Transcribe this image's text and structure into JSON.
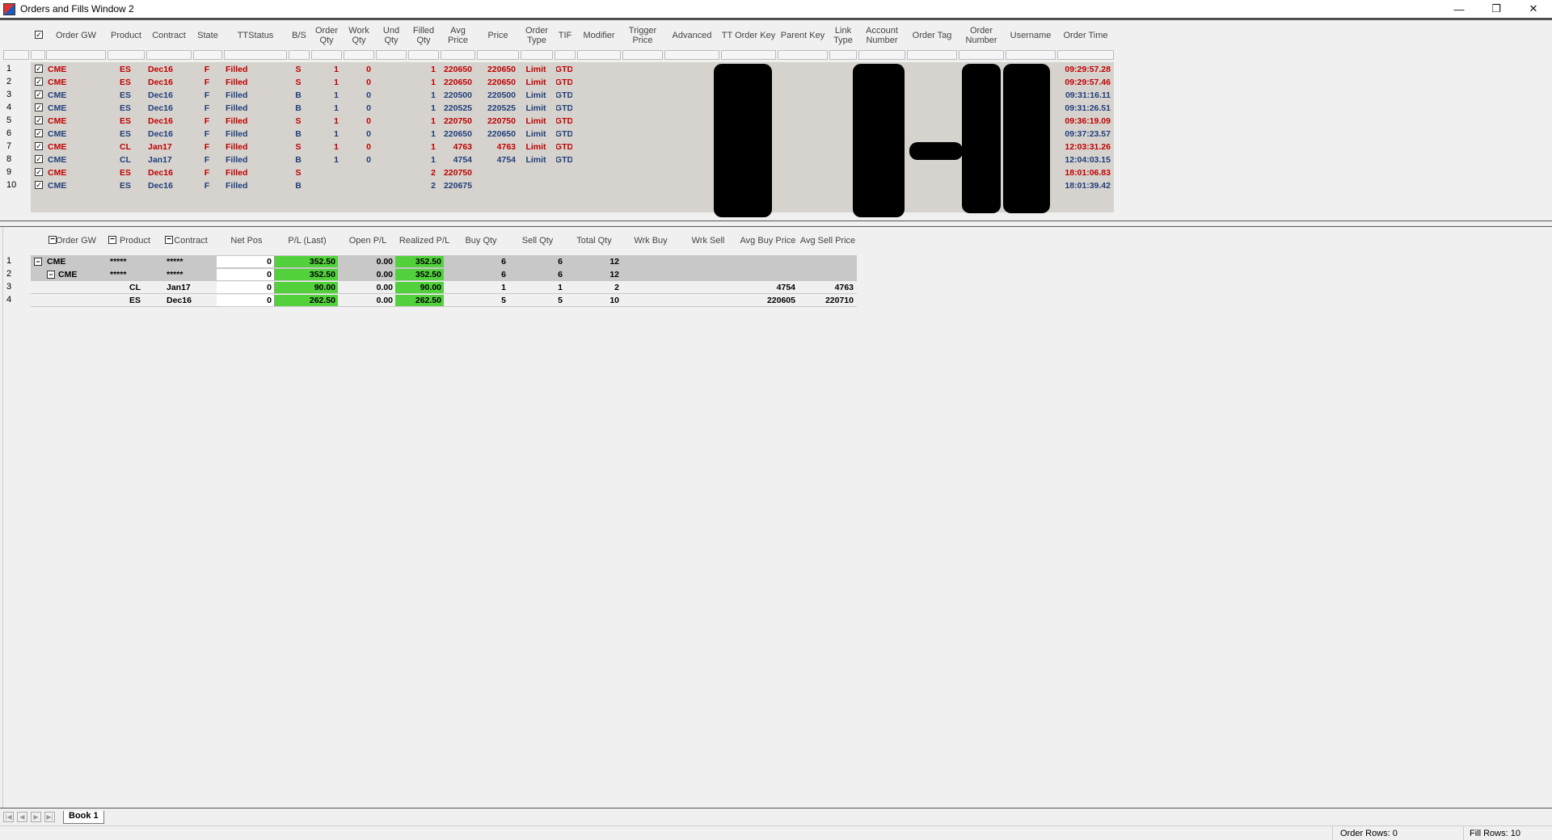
{
  "window": {
    "title": "Orders and Fills Window 2",
    "minimize": "—",
    "restore": "❐",
    "close": "✕"
  },
  "orders": {
    "columns": [
      "Order GW",
      "Product",
      "Contract",
      "State",
      "TTStatus",
      "B/S",
      "Order Qty",
      "Work Qty",
      "Und Qty",
      "Filled Qty",
      "Avg Price",
      "Price",
      "Order Type",
      "TIF",
      "Modifier",
      "Trigger Price",
      "Advanced",
      "TT Order Key",
      "Parent Key",
      "Link Type",
      "Account Number",
      "Order Tag",
      "Order Number",
      "Username",
      "Order Time"
    ],
    "rows": [
      {
        "n": "1",
        "gw": "CME",
        "product": "ES",
        "contract": "Dec16",
        "state": "F",
        "status": "Filled",
        "bs": "S",
        "oqty": "1",
        "wqty": "0",
        "fqty": "1",
        "avg": "220650",
        "price": "220650",
        "type": "Limit",
        "tif": "GTD",
        "time": "09:29:57.28",
        "color": "red"
      },
      {
        "n": "2",
        "gw": "CME",
        "product": "ES",
        "contract": "Dec16",
        "state": "F",
        "status": "Filled",
        "bs": "S",
        "oqty": "1",
        "wqty": "0",
        "fqty": "1",
        "avg": "220650",
        "price": "220650",
        "type": "Limit",
        "tif": "GTD",
        "time": "09:29:57.46",
        "color": "red"
      },
      {
        "n": "3",
        "gw": "CME",
        "product": "ES",
        "contract": "Dec16",
        "state": "F",
        "status": "Filled",
        "bs": "B",
        "oqty": "1",
        "wqty": "0",
        "fqty": "1",
        "avg": "220500",
        "price": "220500",
        "type": "Limit",
        "tif": "GTD",
        "time": "09:31:16.11",
        "color": "blue"
      },
      {
        "n": "4",
        "gw": "CME",
        "product": "ES",
        "contract": "Dec16",
        "state": "F",
        "status": "Filled",
        "bs": "B",
        "oqty": "1",
        "wqty": "0",
        "fqty": "1",
        "avg": "220525",
        "price": "220525",
        "type": "Limit",
        "tif": "GTD",
        "time": "09:31:26.51",
        "color": "blue"
      },
      {
        "n": "5",
        "gw": "CME",
        "product": "ES",
        "contract": "Dec16",
        "state": "F",
        "status": "Filled",
        "bs": "S",
        "oqty": "1",
        "wqty": "0",
        "fqty": "1",
        "avg": "220750",
        "price": "220750",
        "type": "Limit",
        "tif": "GTD",
        "time": "09:36:19.09",
        "color": "red"
      },
      {
        "n": "6",
        "gw": "CME",
        "product": "ES",
        "contract": "Dec16",
        "state": "F",
        "status": "Filled",
        "bs": "B",
        "oqty": "1",
        "wqty": "0",
        "fqty": "1",
        "avg": "220650",
        "price": "220650",
        "type": "Limit",
        "tif": "GTD",
        "time": "09:37:23.57",
        "color": "blue"
      },
      {
        "n": "7",
        "gw": "CME",
        "product": "CL",
        "contract": "Jan17",
        "state": "F",
        "status": "Filled",
        "bs": "S",
        "oqty": "1",
        "wqty": "0",
        "fqty": "1",
        "avg": "4763",
        "price": "4763",
        "type": "Limit",
        "tif": "GTD",
        "time": "12:03:31.26",
        "color": "red"
      },
      {
        "n": "8",
        "gw": "CME",
        "product": "CL",
        "contract": "Jan17",
        "state": "F",
        "status": "Filled",
        "bs": "B",
        "oqty": "1",
        "wqty": "0",
        "fqty": "1",
        "avg": "4754",
        "price": "4754",
        "type": "Limit",
        "tif": "GTD",
        "time": "12:04:03.15",
        "color": "blue"
      },
      {
        "n": "9",
        "gw": "CME",
        "product": "ES",
        "contract": "Dec16",
        "state": "F",
        "status": "Filled",
        "bs": "S",
        "oqty": "",
        "wqty": "",
        "fqty": "2",
        "avg": "220750",
        "price": "",
        "type": "",
        "tif": "",
        "time": "18:01:06.83",
        "color": "red"
      },
      {
        "n": "10",
        "gw": "CME",
        "product": "ES",
        "contract": "Dec16",
        "state": "F",
        "status": "Filled",
        "bs": "B",
        "oqty": "",
        "wqty": "",
        "fqty": "2",
        "avg": "220675",
        "price": "",
        "type": "",
        "tif": "",
        "time": "18:01:39.42",
        "color": "blue"
      }
    ]
  },
  "pl": {
    "columns": [
      "Order GW",
      "Product",
      "Contract",
      "Net Pos",
      "P/L (Last)",
      "Open P/L",
      "Realized P/L",
      "Buy Qty",
      "Sell Qty",
      "Total Qty",
      "Wrk Buy",
      "Wrk Sell",
      "Avg Buy Price",
      "Avg Sell Price"
    ],
    "rows": [
      {
        "n": "1",
        "gw": "CME",
        "product": "*****",
        "contract": "*****",
        "net": "0",
        "pl": "352.50",
        "open": "0.00",
        "real": "352.50",
        "buy": "6",
        "sell": "6",
        "total": "12",
        "avgbuy": "",
        "avgsell": ""
      },
      {
        "n": "2",
        "gw": "CME",
        "product": "*****",
        "contract": "*****",
        "net": "0",
        "pl": "352.50",
        "open": "0.00",
        "real": "352.50",
        "buy": "6",
        "sell": "6",
        "total": "12",
        "avgbuy": "",
        "avgsell": ""
      },
      {
        "n": "3",
        "gw": "",
        "product": "CL",
        "contract": "Jan17",
        "net": "0",
        "pl": "90.00",
        "open": "0.00",
        "real": "90.00",
        "buy": "1",
        "sell": "1",
        "total": "2",
        "avgbuy": "4754",
        "avgsell": "4763"
      },
      {
        "n": "4",
        "gw": "",
        "product": "ES",
        "contract": "Dec16",
        "net": "0",
        "pl": "262.50",
        "open": "0.00",
        "real": "262.50",
        "buy": "5",
        "sell": "5",
        "total": "10",
        "avgbuy": "220605",
        "avgsell": "220710"
      }
    ]
  },
  "tabs": {
    "book": "Book 1"
  },
  "status": {
    "order_rows": "Order Rows: 0",
    "fill_rows": "Fill Rows: 10"
  },
  "colors": {
    "red": "#c00000",
    "blue": "#1f3e7a",
    "green": "#52d13c"
  }
}
